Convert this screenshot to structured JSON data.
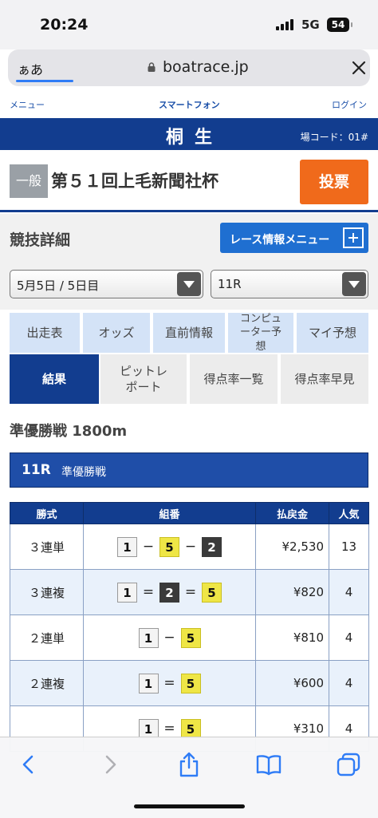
{
  "status": {
    "time": "20:24",
    "network": "5G",
    "battery": "54"
  },
  "browser": {
    "aa_label": "ぁあ",
    "url": "boatrace.jp"
  },
  "topnav": {
    "menu": "メニュー",
    "smartphone": "スマートフォン",
    "login": "ログイン"
  },
  "venue": {
    "name": "桐生",
    "code": "場コード：01#"
  },
  "race_title": {
    "grade": "一般",
    "name": "第５１回上毛新聞社杯",
    "vote_label": "投票"
  },
  "section": {
    "title": "競技詳細",
    "menu_button": "レース情報メニュー"
  },
  "selects": {
    "date": "5月5日 / 5日目",
    "race": "11R"
  },
  "tabs": {
    "row1": [
      "出走表",
      "オッズ",
      "直前情報",
      "コンピューター予想",
      "マイ予想"
    ],
    "row2": [
      "結果",
      "ピットレポート",
      "得点率一覧",
      "得点率早見"
    ]
  },
  "race": {
    "name": "準優勝戦 1800m",
    "number": "11R",
    "type": "準優勝戦"
  },
  "payout_table": {
    "headers": [
      "勝式",
      "組番",
      "払戻金",
      "人気"
    ],
    "rows": [
      {
        "type": "３連単",
        "boats": [
          "1",
          "5",
          "2"
        ],
        "seps": [
          "−",
          "−"
        ],
        "amount": "¥2,530",
        "popularity": "13"
      },
      {
        "type": "３連複",
        "boats": [
          "1",
          "2",
          "5"
        ],
        "seps": [
          "=",
          "="
        ],
        "amount": "¥820",
        "popularity": "4"
      },
      {
        "type": "２連単",
        "boats": [
          "1",
          "5"
        ],
        "seps": [
          "−"
        ],
        "amount": "¥810",
        "popularity": "4"
      },
      {
        "type": "２連複",
        "boats": [
          "1",
          "5"
        ],
        "seps": [
          "="
        ],
        "amount": "¥600",
        "popularity": "4"
      },
      {
        "type": "",
        "boats": [
          "1",
          "5"
        ],
        "seps": [
          "="
        ],
        "amount": "¥310",
        "popularity": "4"
      }
    ]
  },
  "colors": {
    "navy": "#123d8f",
    "accent": "#f06a1b",
    "tab_light": "#d4e3f7"
  },
  "toolbar": {
    "icons": [
      "back-icon",
      "forward-icon",
      "share-icon",
      "bookmarks-icon",
      "tabs-icon"
    ]
  }
}
